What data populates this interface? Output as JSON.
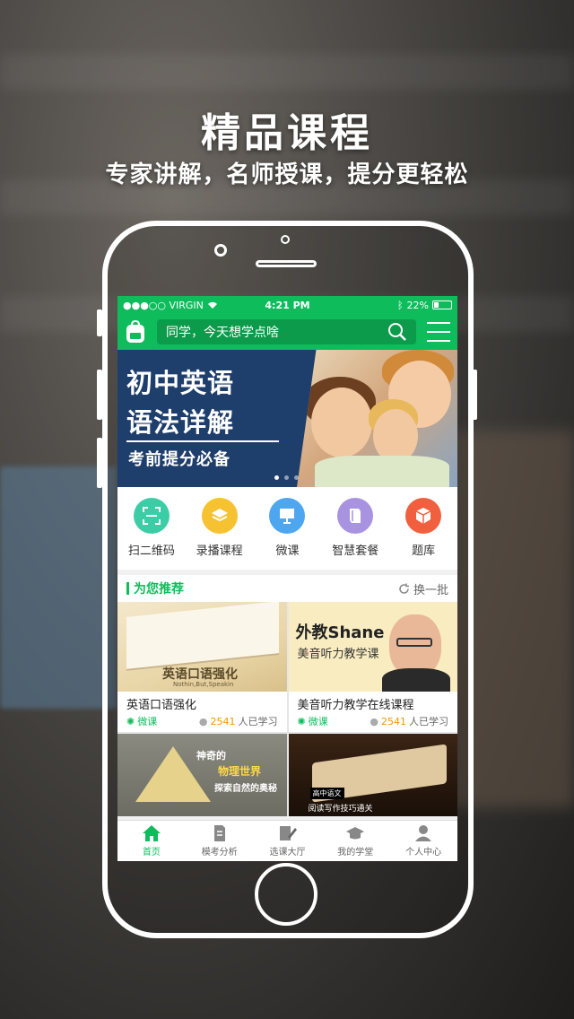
{
  "hero": {
    "title": "精品课程",
    "subtitle": "专家讲解，名师授课，提分更轻松"
  },
  "status": {
    "carrier": "●●●○○ VIRGIN",
    "time": "4:21 PM",
    "battery": "22%"
  },
  "header": {
    "search_placeholder": "同学，今天想学点啥"
  },
  "banner": {
    "line1": "初中英语",
    "line2": "语法详解",
    "line3": "考前提分必备"
  },
  "categories": [
    {
      "label": "扫二维码",
      "icon": "qr-scan-icon",
      "color": "#3ccda6"
    },
    {
      "label": "录播课程",
      "icon": "layers-icon",
      "color": "#f6c232"
    },
    {
      "label": "微课",
      "icon": "presentation-icon",
      "color": "#4ea6ee"
    },
    {
      "label": "智慧套餐",
      "icon": "books-icon",
      "color": "#a893e0"
    },
    {
      "label": "题库",
      "icon": "cube-icon",
      "color": "#f0603f"
    }
  ],
  "recommend": {
    "title": "为您推荐",
    "refresh": "换一批"
  },
  "courses": [
    {
      "name": "英语口语强化",
      "type": "微课",
      "count": "2541",
      "suffix": "人已学习",
      "thumb_title": "英语口语强化",
      "thumb_sub": "Nothin,But,Speakin"
    },
    {
      "name": "美音听力教学在线课程",
      "type": "微课",
      "count": "2541",
      "suffix": "人已学习",
      "thumb_title": "外教Shane",
      "thumb_sub": "美音听力教学课"
    }
  ],
  "courses_more": [
    {
      "l1": "神奇的",
      "l2": "物理世界",
      "l3": "探索自然的奥秘"
    },
    {
      "l1": "高中语文",
      "l2": "阅读写作技巧通关"
    }
  ],
  "tabs": [
    {
      "label": "首页",
      "icon": "home-icon"
    },
    {
      "label": "模考分析",
      "icon": "report-icon"
    },
    {
      "label": "选课大厅",
      "icon": "edit-icon"
    },
    {
      "label": "我的学堂",
      "icon": "graduation-cap-icon"
    },
    {
      "label": "个人中心",
      "icon": "person-icon"
    }
  ],
  "colors": {
    "brand_green": "#0ebc5c",
    "accent_orange": "#f39800"
  }
}
